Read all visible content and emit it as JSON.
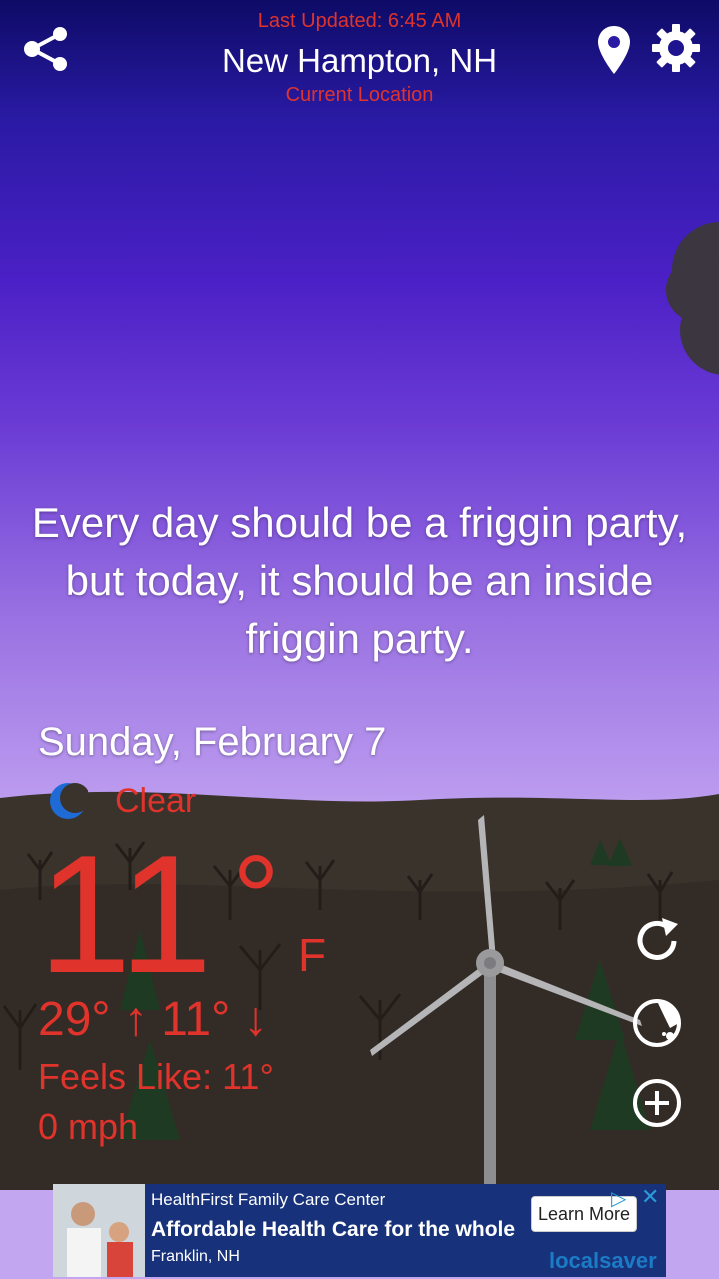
{
  "header": {
    "last_updated": "Last Updated: 6:45 AM",
    "city": "New Hampton, NH",
    "location_label": "Current Location"
  },
  "icons": {
    "share": "share-icon",
    "location": "location-pin-icon",
    "settings": "gear-icon",
    "refresh": "refresh-icon",
    "radar": "radar-icon",
    "add": "add-location-icon",
    "condition": "moon-icon"
  },
  "quote": "Every day should be a friggin party, but today, it should be an inside friggin party.",
  "weather": {
    "date": "Sunday, February 7",
    "condition": "Clear",
    "temperature": "11",
    "degree": "°",
    "unit": "F",
    "high_low": "29° ↑ 11° ↓",
    "feels_like": "Feels Like: 11°",
    "wind": "0 mph"
  },
  "ad": {
    "advertiser": "HealthFirst Family Care Center",
    "headline": "Affordable Health Care for the whole",
    "location": "Franklin, NH",
    "cta": "Learn More",
    "brand": "localsaver",
    "close": "✕",
    "adchoices": "▷"
  },
  "colors": {
    "accent_red": "#e0332b",
    "sky_top": "#0d0b66",
    "sky_bottom": "#c3a6f0",
    "ground": "#3a332c"
  }
}
